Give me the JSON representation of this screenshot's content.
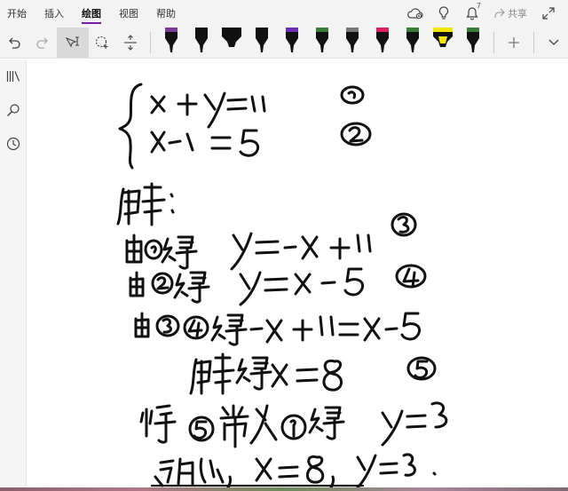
{
  "menu": {
    "tabs": [
      {
        "label": "开始",
        "active": false
      },
      {
        "label": "插入",
        "active": false
      },
      {
        "label": "绘图",
        "active": true
      },
      {
        "label": "视图",
        "active": false
      },
      {
        "label": "帮助",
        "active": false
      }
    ],
    "share_label": "共享",
    "notification_count": "7"
  },
  "accent_color": "#7719aa",
  "toolbar": {
    "tools": [
      "undo-icon",
      "redo-icon",
      "lasso-select-icon",
      "shape-select-icon",
      "insert-space-icon"
    ],
    "pens": [
      {
        "color": "#7a3a98",
        "kind": "pen"
      },
      {
        "color": "#111111",
        "kind": "pen"
      },
      {
        "color": "#111111",
        "kind": "marker"
      },
      {
        "color": "#111111",
        "kind": "pen"
      },
      {
        "color": "#6b2fb5",
        "kind": "pen"
      },
      {
        "color": "#3a7d3a",
        "kind": "pen"
      },
      {
        "color": "#777777",
        "kind": "pen"
      },
      {
        "color": "#e01e5a",
        "kind": "pen"
      },
      {
        "color": "#3a7d3a",
        "kind": "pen"
      },
      {
        "color": "#f3e600",
        "kind": "highlighter"
      },
      {
        "color": "#3a7d3a",
        "kind": "pen"
      }
    ],
    "add_pen_icon": "plus-icon",
    "more_icon": "chevron-down-icon"
  },
  "leftrail": [
    "notebooks-icon",
    "search-icon",
    "recent-icon"
  ],
  "ink_color": "#111111"
}
